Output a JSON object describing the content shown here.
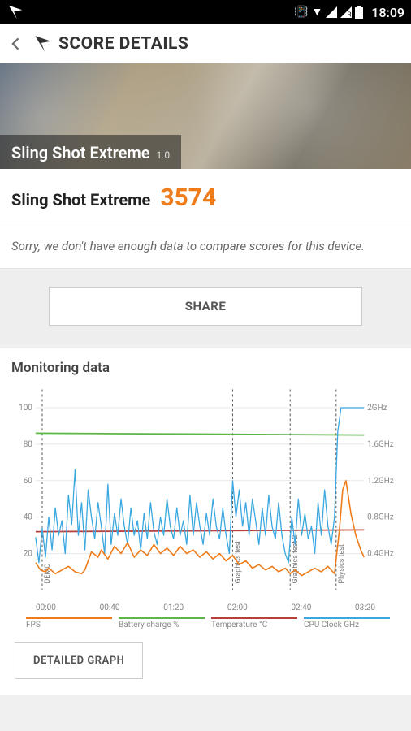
{
  "status": {
    "time": "18:09",
    "signal_r": "R"
  },
  "header": {
    "title": "SCORE DETAILS"
  },
  "hero": {
    "title": "Sling Shot Extreme",
    "version": "1.0"
  },
  "result": {
    "name": "Sling Shot Extreme",
    "score": "3574"
  },
  "message": "Sorry, we don't have enough data to compare scores for this device.",
  "share_label": "SHARE",
  "monitor_title": "Monitoring data",
  "detailed_label": "DETAILED GRAPH",
  "chart_data": {
    "type": "line",
    "x_ticks": [
      "00:00",
      "00:40",
      "01:20",
      "02:00",
      "02:40",
      "03:20"
    ],
    "y_left_ticks": [
      20,
      40,
      60,
      80,
      100
    ],
    "y_right_ticks": [
      "0.4GHz",
      "0.8GHz",
      "1.2GHz",
      "1.6GHz",
      "2GHz"
    ],
    "y_left_range": [
      0,
      110
    ],
    "sections": [
      {
        "label": "DEMO",
        "x": 4
      },
      {
        "label": "Graphics test",
        "x": 120
      },
      {
        "label": "Graphics test 2",
        "x": 155
      },
      {
        "label": "Physics test",
        "x": 183
      }
    ],
    "legend": [
      "FPS",
      "Battery charge %",
      "Temperature °C",
      "CPU Clock GHz"
    ],
    "colors": {
      "fps": "#ef7c1a",
      "battery": "#5fb648",
      "temp": "#b8403a",
      "cpu": "#3aa7e0"
    },
    "series": {
      "battery": [
        [
          0,
          86
        ],
        [
          200,
          85
        ]
      ],
      "temp": [
        [
          0,
          32
        ],
        [
          200,
          33
        ]
      ],
      "fps": [
        [
          0,
          15
        ],
        [
          3,
          11
        ],
        [
          6,
          10
        ],
        [
          8,
          12
        ],
        [
          12,
          9
        ],
        [
          16,
          11
        ],
        [
          20,
          13
        ],
        [
          24,
          10
        ],
        [
          28,
          9
        ],
        [
          30,
          11
        ],
        [
          34,
          21
        ],
        [
          38,
          18
        ],
        [
          40,
          22
        ],
        [
          44,
          17
        ],
        [
          48,
          24
        ],
        [
          52,
          20
        ],
        [
          56,
          26
        ],
        [
          60,
          18
        ],
        [
          64,
          22
        ],
        [
          68,
          19
        ],
        [
          72,
          25
        ],
        [
          76,
          20
        ],
        [
          80,
          23
        ],
        [
          84,
          19
        ],
        [
          88,
          24
        ],
        [
          92,
          20
        ],
        [
          96,
          22
        ],
        [
          100,
          18
        ],
        [
          104,
          21
        ],
        [
          108,
          17
        ],
        [
          112,
          20
        ],
        [
          116,
          16
        ],
        [
          120,
          19
        ],
        [
          124,
          14
        ],
        [
          128,
          16
        ],
        [
          132,
          12
        ],
        [
          136,
          14
        ],
        [
          140,
          11
        ],
        [
          144,
          13
        ],
        [
          148,
          10
        ],
        [
          152,
          12
        ],
        [
          155,
          9
        ],
        [
          158,
          11
        ],
        [
          162,
          8
        ],
        [
          166,
          10
        ],
        [
          170,
          12
        ],
        [
          174,
          10
        ],
        [
          178,
          13
        ],
        [
          182,
          9
        ],
        [
          185,
          33
        ],
        [
          187,
          55
        ],
        [
          189,
          60
        ],
        [
          192,
          42
        ],
        [
          195,
          30
        ],
        [
          198,
          22
        ],
        [
          200,
          18
        ]
      ],
      "cpu": [
        [
          0,
          29
        ],
        [
          2,
          15
        ],
        [
          4,
          34
        ],
        [
          6,
          18
        ],
        [
          8,
          40
        ],
        [
          10,
          22
        ],
        [
          12,
          45
        ],
        [
          14,
          30
        ],
        [
          16,
          38
        ],
        [
          18,
          20
        ],
        [
          20,
          52
        ],
        [
          22,
          36
        ],
        [
          24,
          66
        ],
        [
          26,
          30
        ],
        [
          28,
          48
        ],
        [
          30,
          22
        ],
        [
          32,
          55
        ],
        [
          34,
          40
        ],
        [
          36,
          28
        ],
        [
          38,
          48
        ],
        [
          40,
          35
        ],
        [
          42,
          20
        ],
        [
          44,
          58
        ],
        [
          46,
          25
        ],
        [
          48,
          42
        ],
        [
          50,
          30
        ],
        [
          52,
          50
        ],
        [
          54,
          35
        ],
        [
          56,
          25
        ],
        [
          58,
          45
        ],
        [
          60,
          30
        ],
        [
          62,
          38
        ],
        [
          64,
          22
        ],
        [
          66,
          42
        ],
        [
          68,
          28
        ],
        [
          70,
          48
        ],
        [
          72,
          32
        ],
        [
          74,
          25
        ],
        [
          76,
          40
        ],
        [
          78,
          30
        ],
        [
          80,
          50
        ],
        [
          82,
          35
        ],
        [
          84,
          28
        ],
        [
          86,
          45
        ],
        [
          88,
          30
        ],
        [
          90,
          38
        ],
        [
          92,
          25
        ],
        [
          94,
          52
        ],
        [
          96,
          30
        ],
        [
          98,
          48
        ],
        [
          100,
          35
        ],
        [
          102,
          25
        ],
        [
          104,
          42
        ],
        [
          106,
          30
        ],
        [
          108,
          50
        ],
        [
          110,
          35
        ],
        [
          112,
          28
        ],
        [
          114,
          45
        ],
        [
          116,
          30
        ],
        [
          118,
          20
        ],
        [
          120,
          60
        ],
        [
          122,
          40
        ],
        [
          124,
          55
        ],
        [
          126,
          35
        ],
        [
          128,
          48
        ],
        [
          130,
          30
        ],
        [
          132,
          50
        ],
        [
          134,
          38
        ],
        [
          136,
          25
        ],
        [
          138,
          45
        ],
        [
          140,
          30
        ],
        [
          142,
          52
        ],
        [
          144,
          35
        ],
        [
          146,
          28
        ],
        [
          148,
          48
        ],
        [
          150,
          30
        ],
        [
          152,
          20
        ],
        [
          154,
          15
        ],
        [
          156,
          40
        ],
        [
          158,
          25
        ],
        [
          160,
          50
        ],
        [
          162,
          30
        ],
        [
          164,
          42
        ],
        [
          166,
          28
        ],
        [
          168,
          35
        ],
        [
          170,
          20
        ],
        [
          172,
          48
        ],
        [
          174,
          30
        ],
        [
          176,
          55
        ],
        [
          178,
          35
        ],
        [
          180,
          25
        ],
        [
          182,
          40
        ],
        [
          184,
          87
        ],
        [
          186,
          100
        ],
        [
          188,
          100
        ],
        [
          190,
          100
        ],
        [
          192,
          100
        ],
        [
          194,
          100
        ],
        [
          196,
          100
        ],
        [
          198,
          100
        ],
        [
          200,
          100
        ]
      ]
    }
  }
}
